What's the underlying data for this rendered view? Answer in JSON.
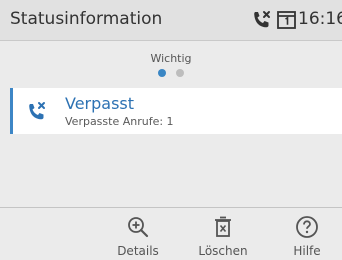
{
  "header": {
    "title": "Statusinformation",
    "time": "16:16",
    "icons": [
      "missed-call-icon",
      "message-box-icon"
    ]
  },
  "pager": {
    "label": "Wichtig",
    "pages": 2,
    "active_page": 1
  },
  "list": {
    "items": [
      {
        "icon": "missed-call-icon",
        "title": "Verpasst",
        "subtitle": "Verpasste Anrufe: 1"
      }
    ]
  },
  "softkeys": [
    {
      "label": "Details",
      "icon": "zoom-in-icon"
    },
    {
      "label": "Löschen",
      "icon": "delete-icon"
    },
    {
      "label": "Hilfe",
      "icon": "help-icon"
    }
  ],
  "colors": {
    "accent": "#3d86c6",
    "title_text": "#2d72b3"
  }
}
